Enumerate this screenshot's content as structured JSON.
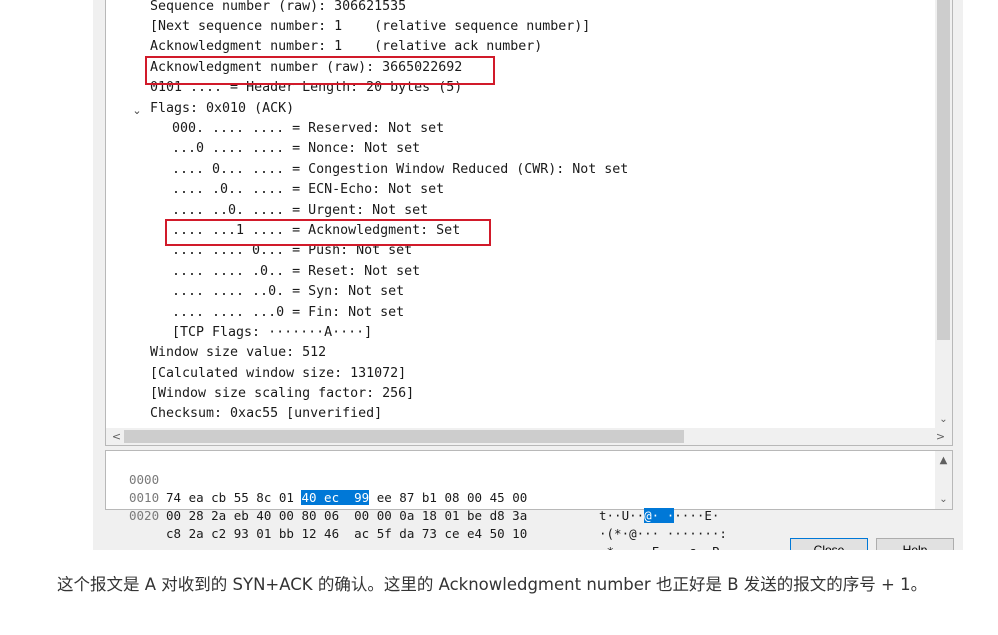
{
  "packet_details": {
    "lines": [
      "Sequence number (raw): 306621535",
      "[Next sequence number: 1    (relative sequence number)]",
      "Acknowledgment number: 1    (relative ack number)",
      "Acknowledgment number (raw): 3665022692",
      "0101 .... = Header Length: 20 bytes (5)",
      "Flags: 0x010 (ACK)",
      "000. .... .... = Reserved: Not set",
      "...0 .... .... = Nonce: Not set",
      ".... 0... .... = Congestion Window Reduced (CWR): Not set",
      ".... .0.. .... = ECN-Echo: Not set",
      ".... ..0. .... = Urgent: Not set",
      ".... ...1 .... = Acknowledgment: Set",
      ".... .... 0... = Push: Not set",
      ".... .... .0.. = Reset: Not set",
      ".... .... ..0. = Syn: Not set",
      ".... .... ...0 = Fin: Not set",
      "[TCP Flags: ·······A····]",
      "Window size value: 512",
      "[Calculated window size: 131072]",
      "[Window size scaling factor: 256]",
      "Checksum: 0xac55 [unverified]"
    ],
    "flags_expander_glyph": "⌄",
    "highlight_color": "#d11a2a"
  },
  "scrollbars": {
    "up": "▲",
    "down": "⌄",
    "left": "<",
    "right": ">"
  },
  "hex_dump": {
    "rows": [
      {
        "offset": "0000",
        "pre": "74 ea cb 55 8c 01 ",
        "sel": "40 ec  99",
        "post": " ee 87 b1 08 00 45 00",
        "ascii_pre": "t··U··",
        "ascii_sel": "@· ·",
        "ascii_post": "····E·"
      },
      {
        "offset": "0010",
        "pre": "00 28 2a eb 40 00 80 06  00 00 0a 18 01 be d8 3a",
        "sel": "",
        "post": "",
        "ascii_pre": "·(*·@··· ·······:",
        "ascii_sel": "",
        "ascii_post": ""
      },
      {
        "offset": "0020",
        "pre": "c8 2a c2 93 01 bb 12 46  ac 5f da 73 ce e4 50 10",
        "sel": "",
        "post": "",
        "ascii_pre": "·*·····F ·_·s··P·",
        "ascii_sel": "",
        "ascii_post": ""
      }
    ],
    "selection_color": "#0078d7"
  },
  "buttons": {
    "close": "Close",
    "help": "Help"
  },
  "caption": "这个报文是 A 对收到的 SYN+ACK 的确认。这里的 Acknowledgment number 也正好是 B 发送的报文的序号 + 1。"
}
